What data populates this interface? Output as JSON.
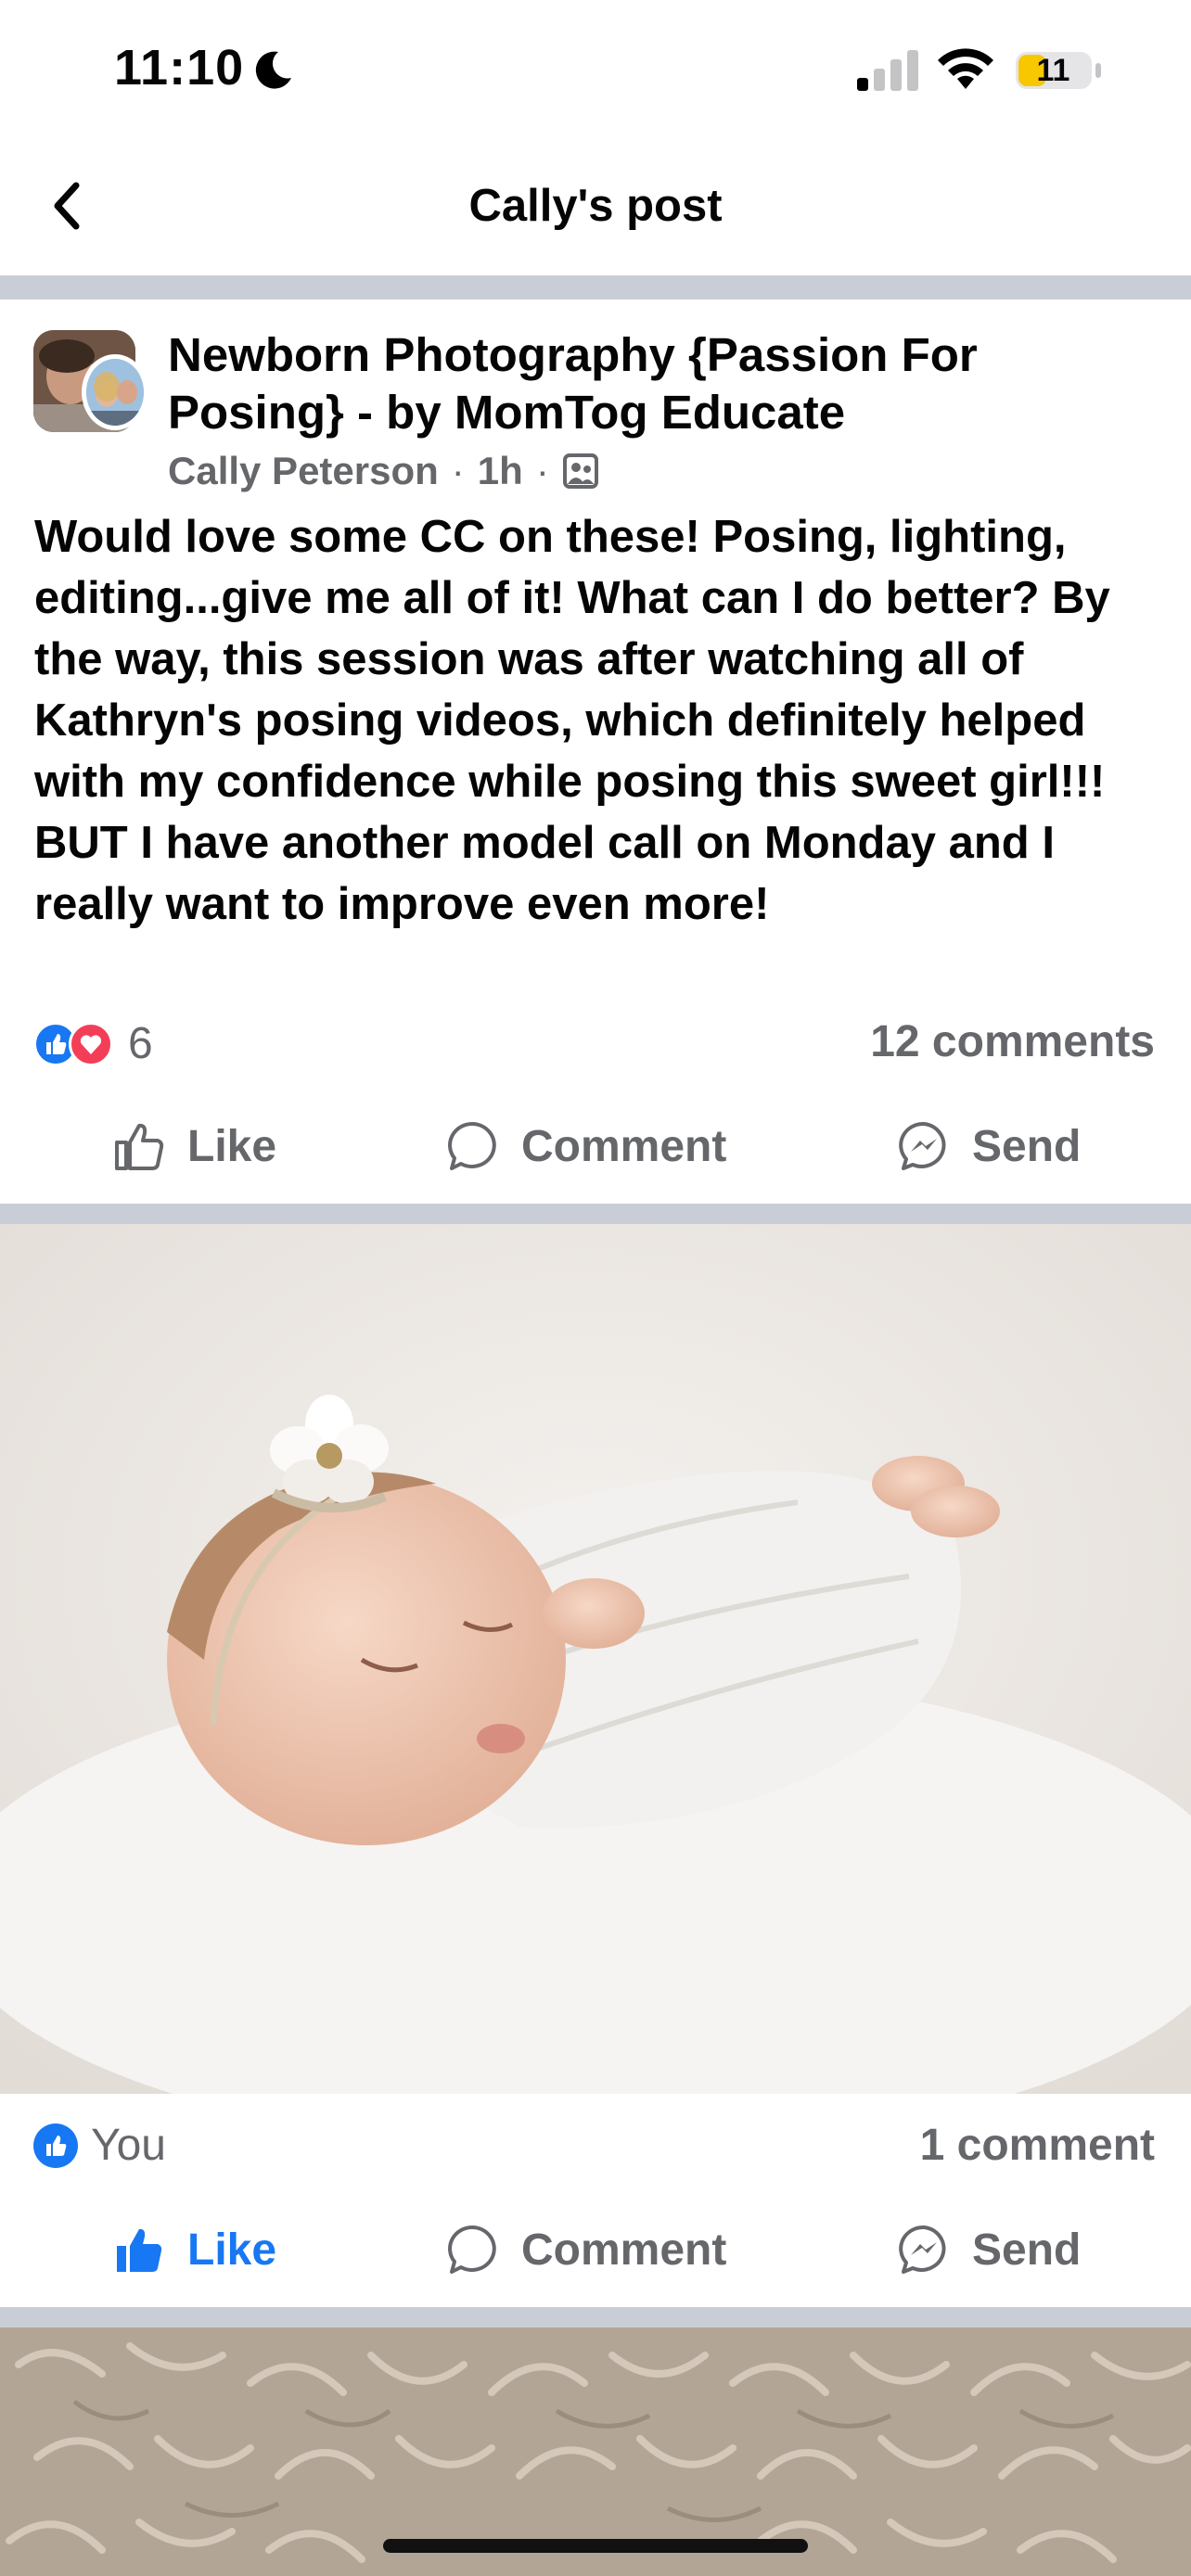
{
  "status_bar": {
    "time": "11:10",
    "battery_level": "11",
    "icons": [
      "moon-icon",
      "cellular-signal-icon",
      "wifi-icon",
      "battery-icon"
    ]
  },
  "header": {
    "title": "Cally's post",
    "back_icon": "chevron-left-icon"
  },
  "post": {
    "group_name": "Newborn Photography {Passion For Posing} - by MomTog Educate",
    "author": "Cally Peterson",
    "time_ago": "1h",
    "separator": "·",
    "audience_icon": "group-members-icon",
    "text": "Would love some CC on these! Posing, lighting, editing...give me all of it! What can I do better? By the way, this session was after watching all of Kathryn's posing videos, which definitely helped with my confidence while posing this sweet girl!!! BUT I have another model call on Monday and I really want to improve even more!",
    "reaction_types": [
      "like",
      "love"
    ],
    "reaction_count": "6",
    "comment_count": "12 comments",
    "actions": {
      "like": "Like",
      "comment": "Comment",
      "send": "Send"
    }
  },
  "photo_1": {
    "reacted_by": "You",
    "comment_count": "1 comment",
    "liked": true,
    "actions": {
      "like": "Like",
      "comment": "Comment",
      "send": "Send"
    }
  },
  "colors": {
    "facebook_blue": "#1877f2",
    "love_red": "#f33e58",
    "secondary_text": "#65676b",
    "divider": "#c9ced6"
  }
}
